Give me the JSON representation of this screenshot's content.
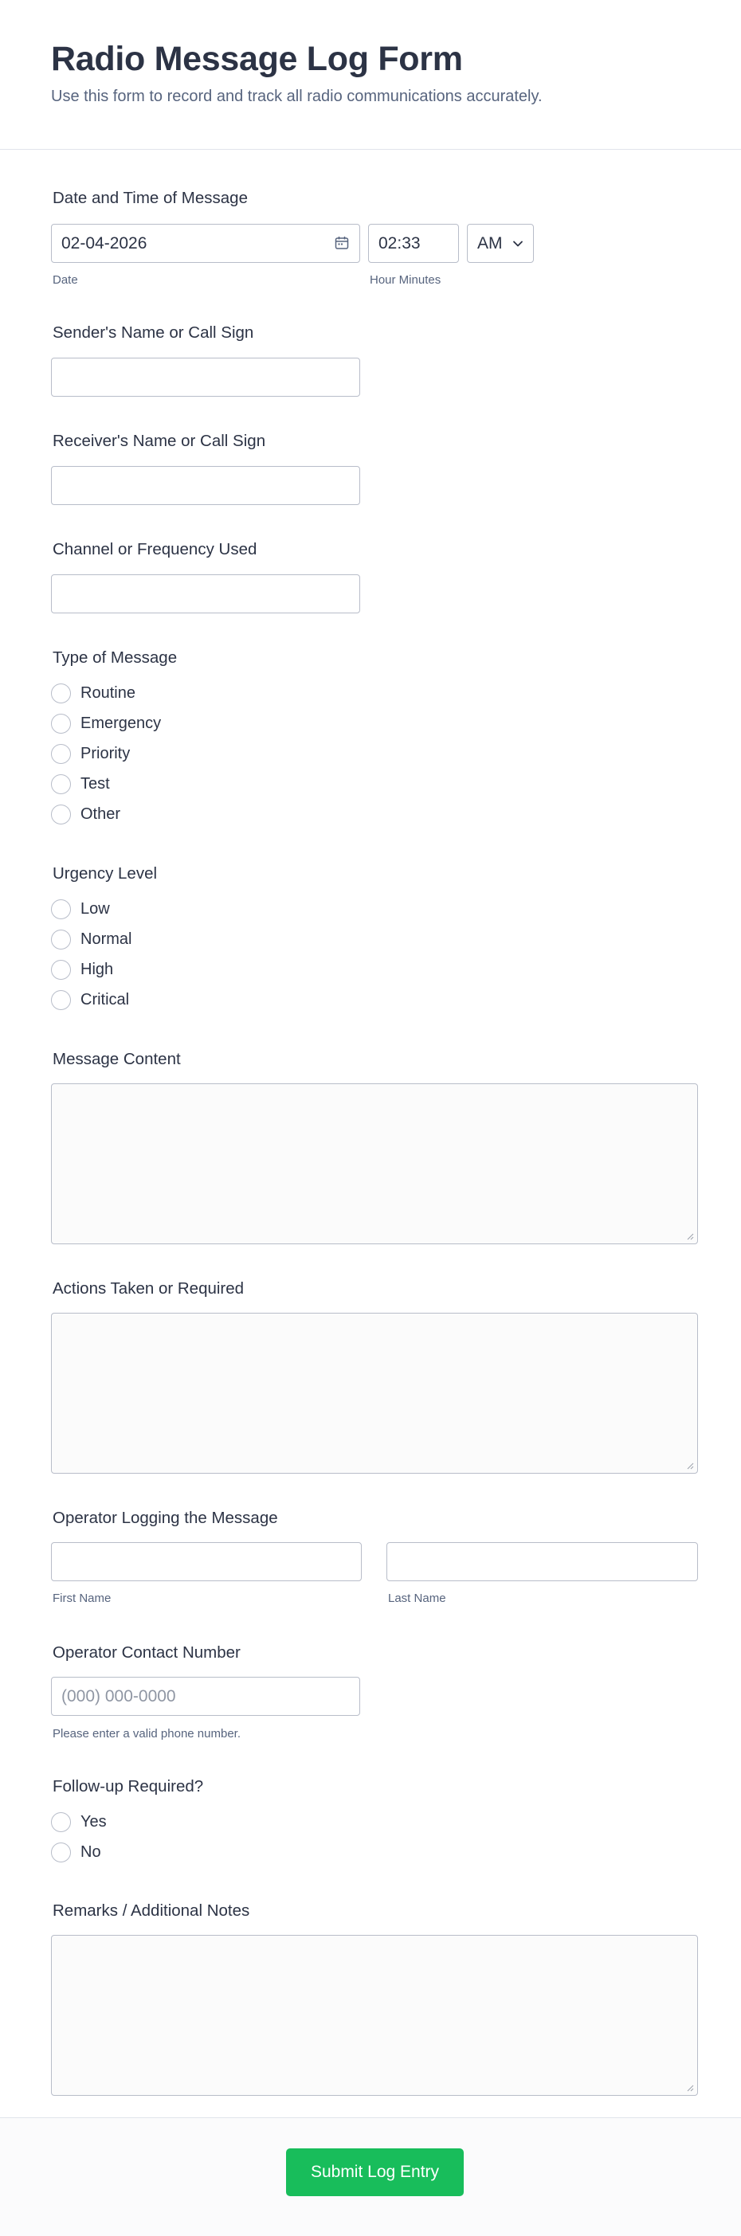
{
  "header": {
    "title": "Radio Message Log Form",
    "subtitle": "Use this form to record and track all radio communications accurately."
  },
  "date_time": {
    "label": "Date and Time of Message",
    "date_value": "02-04-2026",
    "date_sublabel": "Date",
    "time_value": "02:33",
    "time_sublabel": "Hour Minutes",
    "ampm_value": "AM"
  },
  "sender": {
    "label": "Sender's Name or Call Sign",
    "value": ""
  },
  "receiver": {
    "label": "Receiver's Name or Call Sign",
    "value": ""
  },
  "channel": {
    "label": "Channel or Frequency Used",
    "value": ""
  },
  "message_type": {
    "label": "Type of Message",
    "options": [
      "Routine",
      "Emergency",
      "Priority",
      "Test",
      "Other"
    ]
  },
  "urgency": {
    "label": "Urgency Level",
    "options": [
      "Low",
      "Normal",
      "High",
      "Critical"
    ]
  },
  "message_content": {
    "label": "Message Content"
  },
  "actions": {
    "label": "Actions Taken or Required"
  },
  "operator": {
    "label": "Operator Logging the Message",
    "first_sublabel": "First Name",
    "last_sublabel": "Last Name"
  },
  "contact": {
    "label": "Operator Contact Number",
    "placeholder": "(000) 000-0000",
    "hint": "Please enter a valid phone number."
  },
  "followup": {
    "label": "Follow-up Required?",
    "options": [
      "Yes",
      "No"
    ]
  },
  "remarks": {
    "label": "Remarks / Additional Notes"
  },
  "submit": {
    "label": "Submit Log Entry"
  },
  "colors": {
    "submit": "#18bd5b",
    "title": "#2c3345",
    "sublabel": "#57647e",
    "border": "#b8bdc9"
  }
}
